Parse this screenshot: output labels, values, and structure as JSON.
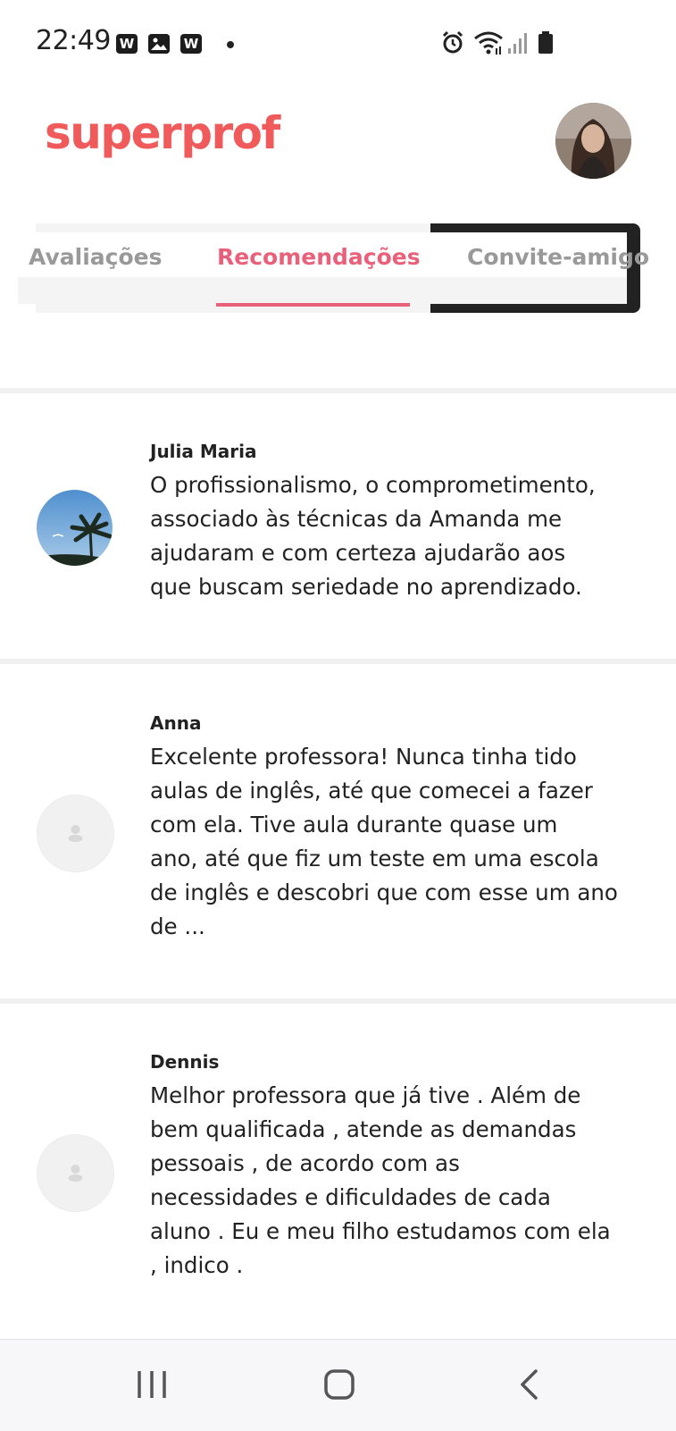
{
  "status_bar": {
    "time": "22:49",
    "left_icons": [
      "w-app-icon",
      "gallery-icon",
      "w-app-icon"
    ],
    "right_icons": [
      "alarm-icon",
      "wifi-icon",
      "signal-icon",
      "battery-icon"
    ]
  },
  "header": {
    "logo_text": "superprof"
  },
  "tabs": [
    {
      "label": "Avaliações",
      "active": false
    },
    {
      "label": "Recomendações",
      "active": true
    },
    {
      "label": "Convite-amigo",
      "active": false
    }
  ],
  "reviews": [
    {
      "name": "Julia Maria",
      "avatar": "photo",
      "lines": [
        "O profissionalismo, o comprometimento,",
        "associado às técnicas da Amanda me",
        "ajudaram e com certeza ajudarão aos",
        "que buscam seriedade no aprendizado."
      ]
    },
    {
      "name": "Anna",
      "avatar": "placeholder",
      "lines": [
        "Excelente professora! Nunca tinha tido",
        "aulas de inglês, até que comecei a fazer",
        "com ela. Tive aula durante quase um",
        "ano, até que fiz um teste em uma escola",
        "de inglês e descobri que com esse um ano",
        "de ..."
      ]
    },
    {
      "name": "Dennis",
      "avatar": "placeholder",
      "lines": [
        "Melhor professora que já tive . Além de",
        "bem qualificada , atende as demandas",
        "pessoais , de acordo com as",
        "necessidades e dificuldades de cada",
        "aluno . Eu e meu filho estudamos com ela",
        ", indico ."
      ]
    }
  ],
  "colors": {
    "brand": "#f05a5a",
    "active_tab": "#e8607a",
    "inactive_tab": "#999999",
    "text": "#222222"
  },
  "nav_bar": {
    "buttons": [
      "recent-apps-icon",
      "home-icon",
      "back-icon"
    ]
  }
}
